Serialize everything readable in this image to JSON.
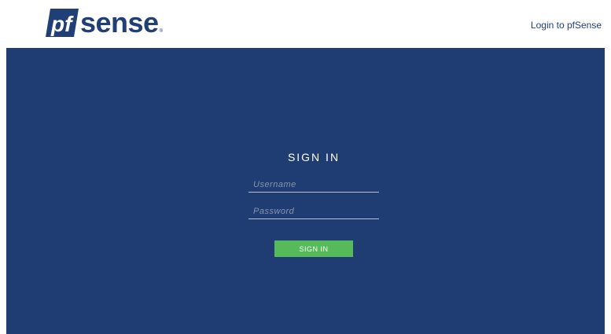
{
  "header": {
    "logo_word": "sense",
    "logo_mark_text": "pf",
    "logo_reg": "®",
    "login_link": "Login to pfSense"
  },
  "login": {
    "title": "SIGN IN",
    "username_placeholder": "Username",
    "username_value": "",
    "password_placeholder": "Password",
    "password_value": "",
    "submit_label": "SIGN IN"
  },
  "colors": {
    "brand_blue": "#1f3d72",
    "button_green": "#56b95a",
    "logo_blue": "#1f3f76"
  },
  "icons": {
    "logo": "pfsense-logo-icon"
  }
}
